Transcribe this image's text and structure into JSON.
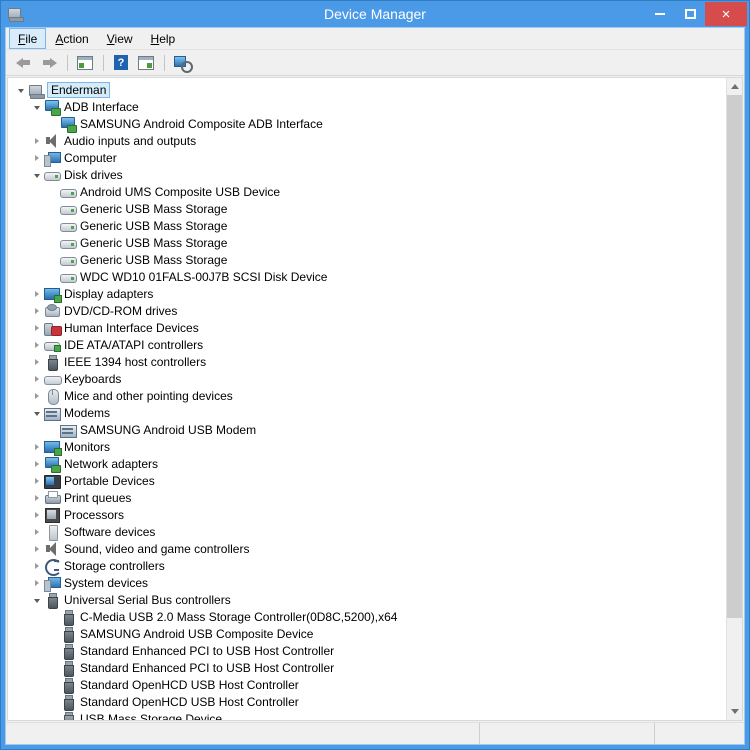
{
  "window": {
    "title": "Device Manager",
    "icon": "device-manager-icon",
    "controls": {
      "minimize": "minimize-button",
      "maximize": "maximize-button",
      "close": "×"
    },
    "accent_color": "#4a9ae8",
    "close_color": "#d64b4b"
  },
  "menubar": {
    "items": [
      {
        "label": "File",
        "accel": "F",
        "focused": true
      },
      {
        "label": "Action",
        "accel": "A",
        "focused": false
      },
      {
        "label": "View",
        "accel": "V",
        "focused": false
      },
      {
        "label": "Help",
        "accel": "H",
        "focused": false
      }
    ]
  },
  "toolbar": {
    "buttons": [
      {
        "name": "back-button",
        "icon": "arrow-left-icon"
      },
      {
        "name": "forward-button",
        "icon": "arrow-right-icon"
      },
      {
        "name": "properties-button",
        "icon": "properties-panel-icon"
      },
      {
        "name": "help-button",
        "icon": "help-question-icon",
        "glyph": "?"
      },
      {
        "name": "show-hide-console-tree-button",
        "icon": "console-tree-icon"
      },
      {
        "name": "scan-for-hardware-changes-button",
        "icon": "scan-hardware-icon"
      }
    ]
  },
  "tree": {
    "nodes": [
      {
        "label": "Enderman",
        "depth": 0,
        "state": "expanded",
        "icon": "computer-icon",
        "selected": true
      },
      {
        "label": "ADB Interface",
        "depth": 1,
        "state": "expanded",
        "icon": "network-device-icon",
        "selected": false
      },
      {
        "label": "SAMSUNG Android Composite ADB Interface",
        "depth": 2,
        "state": "leaf",
        "icon": "network-device-icon",
        "selected": false
      },
      {
        "label": "Audio inputs and outputs",
        "depth": 1,
        "state": "collapsed",
        "icon": "speaker-icon",
        "selected": false
      },
      {
        "label": "Computer",
        "depth": 1,
        "state": "collapsed",
        "icon": "system-device-icon",
        "selected": false
      },
      {
        "label": "Disk drives",
        "depth": 1,
        "state": "expanded",
        "icon": "disk-drive-icon",
        "selected": false
      },
      {
        "label": "Android  UMS Composite USB Device",
        "depth": 2,
        "state": "leaf",
        "icon": "disk-drive-icon",
        "selected": false
      },
      {
        "label": "Generic USB Mass Storage",
        "depth": 2,
        "state": "leaf",
        "icon": "disk-drive-icon",
        "selected": false
      },
      {
        "label": "Generic USB Mass Storage",
        "depth": 2,
        "state": "leaf",
        "icon": "disk-drive-icon",
        "selected": false
      },
      {
        "label": "Generic USB Mass Storage",
        "depth": 2,
        "state": "leaf",
        "icon": "disk-drive-icon",
        "selected": false
      },
      {
        "label": "Generic USB Mass Storage",
        "depth": 2,
        "state": "leaf",
        "icon": "disk-drive-icon",
        "selected": false
      },
      {
        "label": "WDC WD10 01FALS-00J7B SCSI Disk Device",
        "depth": 2,
        "state": "leaf",
        "icon": "disk-drive-icon",
        "selected": false
      },
      {
        "label": "Display adapters",
        "depth": 1,
        "state": "collapsed",
        "icon": "display-adapter-icon",
        "selected": false
      },
      {
        "label": "DVD/CD-ROM drives",
        "depth": 1,
        "state": "collapsed",
        "icon": "dvd-drive-icon",
        "selected": false
      },
      {
        "label": "Human Interface Devices",
        "depth": 1,
        "state": "collapsed",
        "icon": "hid-icon",
        "selected": false
      },
      {
        "label": "IDE ATA/ATAPI controllers",
        "depth": 1,
        "state": "collapsed",
        "icon": "ide-controller-icon",
        "selected": false
      },
      {
        "label": "IEEE 1394 host controllers",
        "depth": 1,
        "state": "collapsed",
        "icon": "usb-connector-icon",
        "selected": false
      },
      {
        "label": "Keyboards",
        "depth": 1,
        "state": "collapsed",
        "icon": "keyboard-icon",
        "selected": false
      },
      {
        "label": "Mice and other pointing devices",
        "depth": 1,
        "state": "collapsed",
        "icon": "mouse-icon",
        "selected": false
      },
      {
        "label": "Modems",
        "depth": 1,
        "state": "expanded",
        "icon": "modem-icon",
        "selected": false
      },
      {
        "label": "SAMSUNG Android USB Modem",
        "depth": 2,
        "state": "leaf",
        "icon": "modem-icon",
        "selected": false
      },
      {
        "label": "Monitors",
        "depth": 1,
        "state": "collapsed",
        "icon": "display-adapter-icon",
        "selected": false
      },
      {
        "label": "Network adapters",
        "depth": 1,
        "state": "collapsed",
        "icon": "network-device-icon",
        "selected": false
      },
      {
        "label": "Portable Devices",
        "depth": 1,
        "state": "collapsed",
        "icon": "portable-device-icon",
        "selected": false
      },
      {
        "label": "Print queues",
        "depth": 1,
        "state": "collapsed",
        "icon": "printer-icon",
        "selected": false
      },
      {
        "label": "Processors",
        "depth": 1,
        "state": "collapsed",
        "icon": "processor-icon",
        "selected": false
      },
      {
        "label": "Software devices",
        "depth": 1,
        "state": "collapsed",
        "icon": "software-device-icon",
        "selected": false
      },
      {
        "label": "Sound, video and game controllers",
        "depth": 1,
        "state": "collapsed",
        "icon": "speaker-icon",
        "selected": false
      },
      {
        "label": "Storage controllers",
        "depth": 1,
        "state": "collapsed",
        "icon": "storage-controller-icon",
        "selected": false
      },
      {
        "label": "System devices",
        "depth": 1,
        "state": "collapsed",
        "icon": "system-device-icon",
        "selected": false
      },
      {
        "label": "Universal Serial Bus controllers",
        "depth": 1,
        "state": "expanded",
        "icon": "usb-connector-icon",
        "selected": false
      },
      {
        "label": "C-Media USB 2.0 Mass Storage Controller(0D8C,5200),x64",
        "depth": 2,
        "state": "leaf",
        "icon": "usb-connector-icon",
        "selected": false
      },
      {
        "label": "SAMSUNG Android USB Composite Device",
        "depth": 2,
        "state": "leaf",
        "icon": "usb-connector-icon",
        "selected": false
      },
      {
        "label": "Standard Enhanced PCI to USB Host Controller",
        "depth": 2,
        "state": "leaf",
        "icon": "usb-connector-icon",
        "selected": false
      },
      {
        "label": "Standard Enhanced PCI to USB Host Controller",
        "depth": 2,
        "state": "leaf",
        "icon": "usb-connector-icon",
        "selected": false
      },
      {
        "label": "Standard OpenHCD USB Host Controller",
        "depth": 2,
        "state": "leaf",
        "icon": "usb-connector-icon",
        "selected": false
      },
      {
        "label": "Standard OpenHCD USB Host Controller",
        "depth": 2,
        "state": "leaf",
        "icon": "usb-connector-icon",
        "selected": false
      },
      {
        "label": "USB Mass Storage Device",
        "depth": 2,
        "state": "leaf",
        "icon": "usb-mass-storage-icon",
        "selected": false
      }
    ]
  },
  "scrollbar": {
    "up_arrow": "scroll-up-arrow",
    "down_arrow": "scroll-down-arrow",
    "thumb_top_percent": 0,
    "thumb_height_percent": 86
  },
  "statusbar": {
    "main": "",
    "pane1": "",
    "pane2": ""
  }
}
